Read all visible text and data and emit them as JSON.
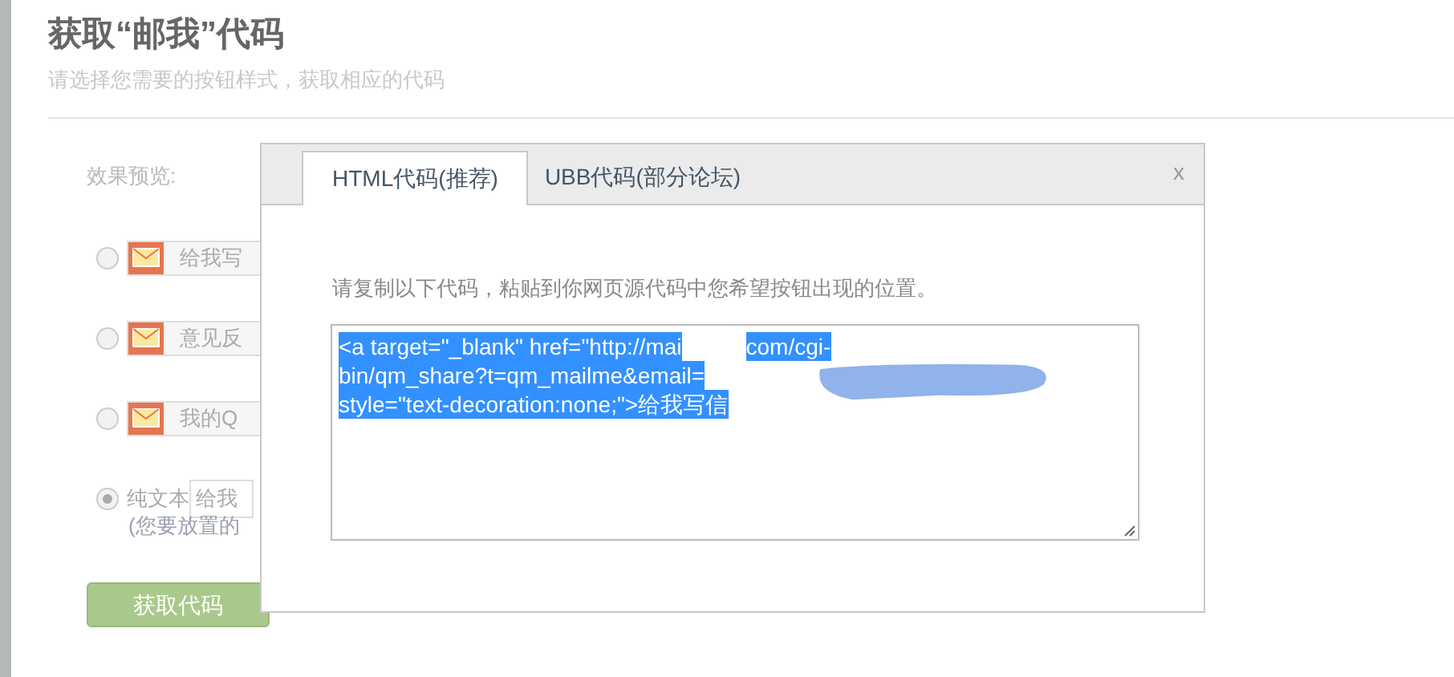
{
  "page": {
    "title": "获取“邮我”代码",
    "subtitle": "请选择您需要的按钮样式，获取相应的代码"
  },
  "preview": {
    "label": "效果预览:",
    "options": [
      {
        "kind": "button",
        "label": "给我写",
        "selected": false
      },
      {
        "kind": "button",
        "label": "意见反",
        "selected": false
      },
      {
        "kind": "button",
        "label": "我的Q",
        "selected": false
      },
      {
        "kind": "text",
        "label": "纯文本",
        "value": "给我",
        "selected": true
      }
    ],
    "hint": "(您要放置的"
  },
  "get_code_button": "获取代码",
  "dialog": {
    "tabs": [
      {
        "label": "HTML代码(推荐)",
        "selected": true
      },
      {
        "label": "UBB代码(部分论坛)",
        "selected": false
      }
    ],
    "close": "x",
    "instruction": "请复制以下代码，粘贴到你网页源代码中您希望按钮出现的位置。",
    "code_lines": [
      [
        "<a target=\"_blank\" href=\"http://mai",
        "com/cgi-"
      ],
      [
        "bin/qm_share?t=qm_mailme&email="
      ],
      [
        "style=\"text-decoration:none;\">给我写信"
      ]
    ]
  }
}
